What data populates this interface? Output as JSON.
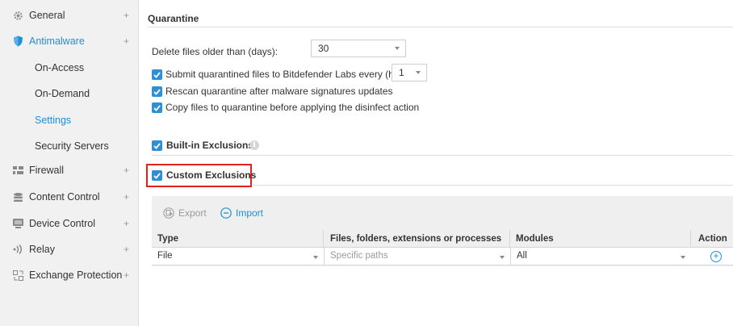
{
  "sidebar": {
    "items": [
      {
        "label": "General",
        "plus": "+",
        "icon": "gear-icon"
      },
      {
        "label": "Antimalware",
        "plus": "+",
        "icon": "shield-icon"
      },
      {
        "label": "On-Access"
      },
      {
        "label": "On-Demand"
      },
      {
        "label": "Settings"
      },
      {
        "label": "Security Servers"
      },
      {
        "label": "Firewall",
        "plus": "+",
        "icon": "firewall-icon"
      },
      {
        "label": "Content Control",
        "plus": "+",
        "icon": "content-control-icon"
      },
      {
        "label": "Device Control",
        "plus": "+",
        "icon": "device-control-icon"
      },
      {
        "label": "Relay",
        "plus": "+",
        "icon": "relay-icon"
      },
      {
        "label": "Exchange Protection",
        "plus": "+",
        "icon": "exchange-icon"
      }
    ]
  },
  "quarantine": {
    "title": "Quarantine",
    "delete_label": "Delete files older than (days):",
    "delete_value": "30",
    "submit_label": "Submit quarantined files to Bitdefender Labs every (hours)",
    "submit_value": "1",
    "rescan_label": "Rescan quarantine after malware signatures updates",
    "copy_label": "Copy files to quarantine before applying the disinfect action"
  },
  "builtin": {
    "label": "Built-in Exclusions",
    "info": "i"
  },
  "custom": {
    "label": "Custom Exclusions"
  },
  "toolbar": {
    "export_label": "Export",
    "import_label": "Import"
  },
  "grid": {
    "columns": [
      "Type",
      "Files, folders, extensions or processes",
      "Modules",
      "Action"
    ],
    "row": {
      "type": "File",
      "paths_placeholder": "Specific paths",
      "modules": "All",
      "add": "+"
    }
  },
  "colors": {
    "accent": "#1f8fd9",
    "checkbox": "#2d8fd5",
    "highlight": "#e32020"
  }
}
